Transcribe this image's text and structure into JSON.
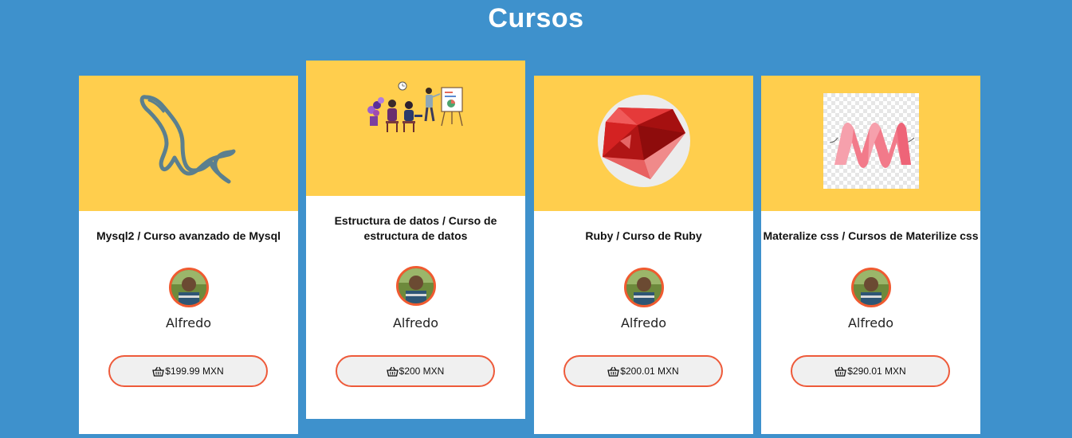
{
  "page": {
    "title": "Cursos"
  },
  "courses": [
    {
      "title": "Mysql2 / Curso avanzado de Mysql",
      "author": "Alfredo",
      "price": "$199.99 MXN",
      "icon": "mysql-dolphin-icon"
    },
    {
      "title": "Estructura de datos / Curso de estructura de datos",
      "author": "Alfredo",
      "price": "$200 MXN",
      "icon": "classroom-illustration"
    },
    {
      "title": "Ruby / Curso de Ruby",
      "author": "Alfredo",
      "price": "$200.01 MXN",
      "icon": "ruby-gem-icon"
    },
    {
      "title": "Materalize css / Cursos de Materilize css",
      "author": "Alfredo",
      "price": "$290.01 MXN",
      "icon": "materialize-logo-icon"
    }
  ],
  "colors": {
    "background": "#3e91cc",
    "card_header": "#ffce4d",
    "button_border": "#ee5a3a",
    "avatar_ring": "#f05a30"
  }
}
